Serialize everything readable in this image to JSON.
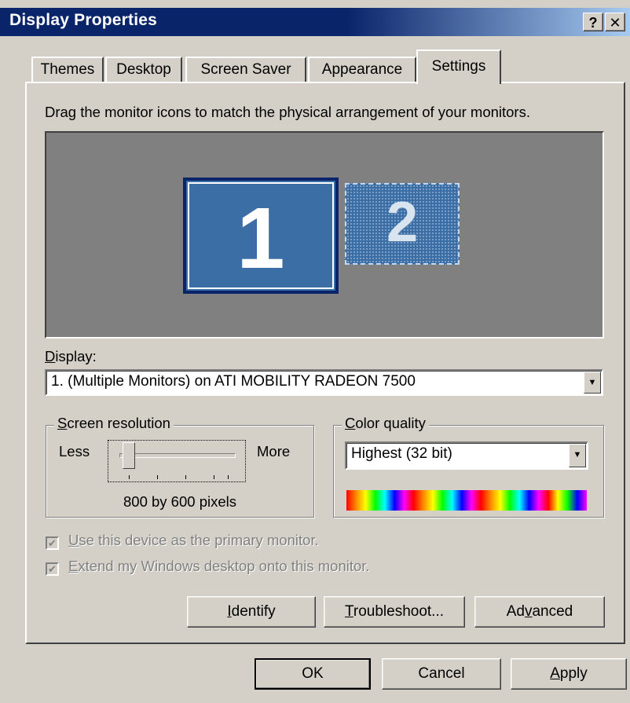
{
  "window": {
    "title": "Display Properties",
    "help_glyph": "?",
    "close_glyph": "✕"
  },
  "tabs": [
    {
      "label": "Themes",
      "active": false
    },
    {
      "label": "Desktop",
      "active": false
    },
    {
      "label": "Screen Saver",
      "active": false
    },
    {
      "label": "Appearance",
      "active": false
    },
    {
      "label": "Settings",
      "active": true
    }
  ],
  "settings": {
    "instructions": "Drag the monitor icons to match the physical arrangement of your monitors.",
    "monitors": [
      {
        "number": "1",
        "selected": true,
        "attached": true
      },
      {
        "number": "2",
        "selected": false,
        "attached": false
      }
    ],
    "display_label": {
      "accel": "D",
      "rest": "isplay:"
    },
    "display_value": "1. (Multiple Monitors) on ATI MOBILITY RADEON 7500",
    "screen_resolution": {
      "title_accel": "S",
      "title_rest": "creen resolution",
      "less_label": "Less",
      "more_label": "More",
      "value_text": "800 by 600 pixels",
      "slider_position": 0
    },
    "color_quality": {
      "title_accel": "C",
      "title_rest": "olor quality",
      "value": "Highest (32 bit)"
    },
    "checkboxes": [
      {
        "accel": "U",
        "rest": "se this device as the primary monitor.",
        "checked": true,
        "enabled": false
      },
      {
        "accel": "E",
        "rest": "xtend my Windows desktop onto this monitor.",
        "checked": true,
        "enabled": false
      }
    ],
    "buttons": {
      "identify": {
        "accel": "I",
        "rest": "dentify"
      },
      "troubleshoot": {
        "accel": "T",
        "rest": "roubleshoot..."
      },
      "advanced": {
        "pre": "Ad",
        "accel": "v",
        "rest": "anced"
      }
    }
  },
  "footer": {
    "ok": "OK",
    "cancel": "Cancel",
    "apply": {
      "accel": "A",
      "rest": "pply"
    }
  },
  "colors": {
    "titlebar": "#0a246a",
    "face": "#d4d0c8",
    "monitor_bg": "#808080",
    "monitor_blue": "#3a6ea5"
  }
}
